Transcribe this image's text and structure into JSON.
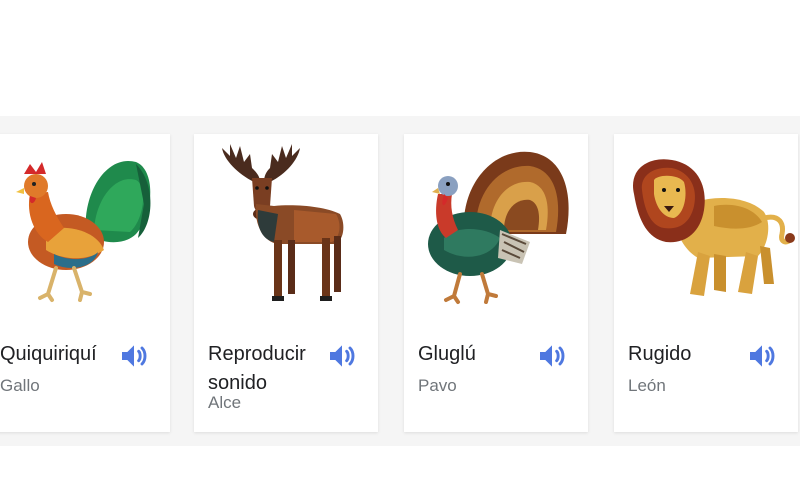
{
  "cards": [
    {
      "title": "Quiquiriquí",
      "subtitle": "Gallo",
      "animal_icon": "rooster-icon",
      "sound_icon": "speaker-icon"
    },
    {
      "title": "Reproducir sonido",
      "subtitle": "Alce",
      "animal_icon": "moose-icon",
      "sound_icon": "speaker-icon"
    },
    {
      "title": "Gluglú",
      "subtitle": "Pavo",
      "animal_icon": "turkey-icon",
      "sound_icon": "speaker-icon"
    },
    {
      "title": "Rugido",
      "subtitle": "León",
      "animal_icon": "lion-icon",
      "sound_icon": "speaker-icon"
    }
  ],
  "colors": {
    "speaker": "#4f78e0",
    "title_text": "#202124",
    "subtitle_text": "#70757a",
    "band": "#f5f5f5"
  }
}
